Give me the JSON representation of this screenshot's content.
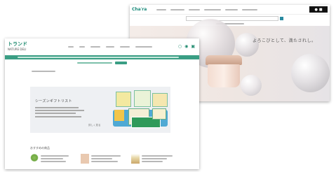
{
  "back_window": {
    "logo": "Cha′ra",
    "hero_copy": "よろこびとして、満たされし。",
    "colors": {
      "brand": "#1a8a7a",
      "hero_bg": "#f0e8e4"
    }
  },
  "front_window": {
    "logo_main": "トランド",
    "logo_sub": "NATURE DELI",
    "banner_title": "シーズンギフトリスト",
    "banner_more": "詳しく見る",
    "section_title": "おすすめの商品",
    "colors": {
      "brand": "#1e8a6e",
      "band": "#3a9e84"
    }
  }
}
